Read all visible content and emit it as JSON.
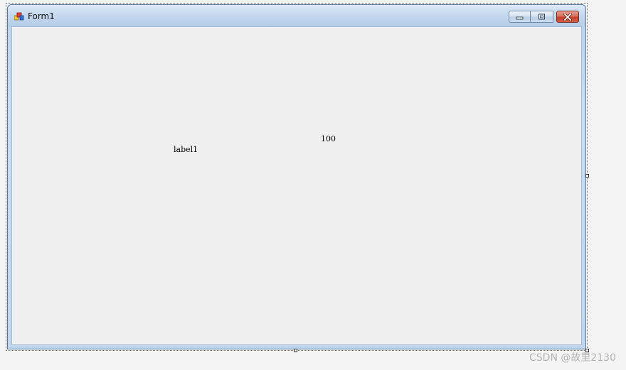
{
  "window": {
    "title": "Form1",
    "icon": "form-app-icon",
    "buttons": {
      "minimize": "minimize-icon",
      "maximize": "maximize-icon",
      "close": "close-icon"
    },
    "colors": {
      "client_bg": "#f0f0f0",
      "frame": "#b9d1ea",
      "close_red": "#c1412a"
    }
  },
  "labels": {
    "label1": "label1",
    "value": "100"
  },
  "watermark": "CSDN @故里2130"
}
